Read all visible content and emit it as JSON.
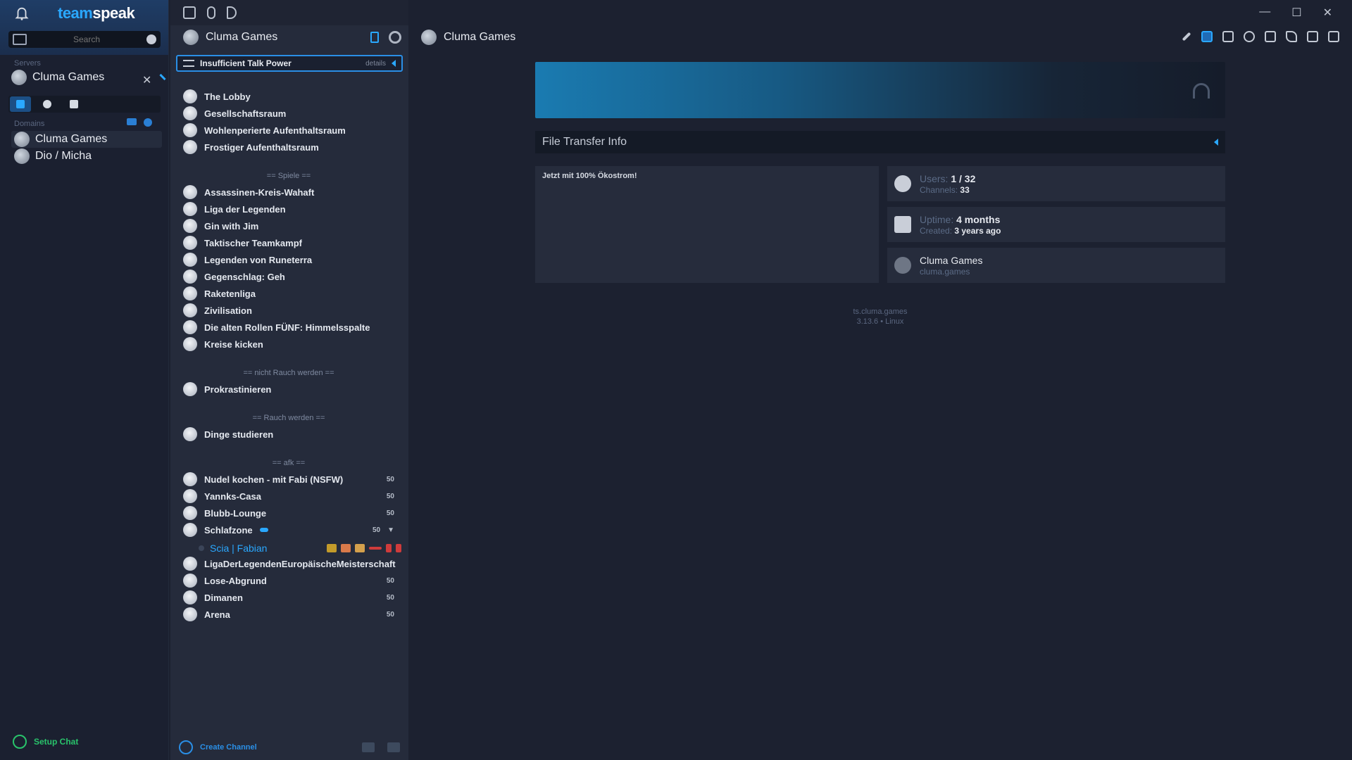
{
  "app": {
    "brand_part1": "team",
    "brand_part2": "speak"
  },
  "sidebar": {
    "search_placeholder": "Search",
    "servers_label": "Servers",
    "active_server": "Cluma Games",
    "domains_label": "Domains",
    "domain_items": [
      {
        "label": "Cluma Games"
      },
      {
        "label": "Dio / Micha"
      }
    ],
    "setup_chat": "Setup Chat"
  },
  "tree": {
    "server_name": "Cluma Games",
    "notice": {
      "text": "Insufficient Talk Power",
      "details": "details"
    },
    "group1": [
      "The Lobby",
      "Gesellschaftsraum",
      "Wohlenperierte Aufenthaltsraum",
      "Frostiger Aufenthaltsraum"
    ],
    "spacer_games": "== Spiele ==",
    "group2": [
      "Assassinen-Kreis-Wahaft",
      "Liga der Legenden",
      "Gin with Jim",
      "Taktischer Teamkampf",
      "Legenden von Runeterra",
      "Gegenschlag: Geh",
      "Raketenliga",
      "Zivilisation",
      "Die alten Rollen FÜNF: Himmelsspalte",
      "Kreise kicken"
    ],
    "spacer_no_touch": "== nicht Rauch werden ==",
    "group3": [
      "Prokrastinieren"
    ],
    "spacer_touch": "== Rauch werden ==",
    "group4": [
      "Dinge studieren"
    ],
    "spacer_afk": "== afk ==",
    "group5": [
      {
        "name": "Nudel kochen - mit Fabi (NSFW)",
        "count": "50"
      },
      {
        "name": "Yannks-Casa",
        "count": "50"
      },
      {
        "name": "Blubb-Lounge",
        "count": "50"
      },
      {
        "name": "Schlafzone",
        "count": "50"
      }
    ],
    "user": {
      "name": "Scia | Fabian"
    },
    "group6": [
      {
        "name": "LigaDerLegendenEuropäischeMeisterschaft",
        "count": ""
      },
      {
        "name": "Lose-Abgrund",
        "count": "50"
      },
      {
        "name": "Dimanen",
        "count": "50"
      },
      {
        "name": "Arena",
        "count": "50"
      }
    ],
    "create_channel": "Create Channel"
  },
  "main": {
    "title": "Cluma Games",
    "file_transfer": "File Transfer Info",
    "description": "Jetzt mit 100% Ökostrom!",
    "stats": {
      "users_k": "Users:",
      "users_v": "1 / 32",
      "channels_k": "Channels:",
      "channels_v": "33",
      "uptime_k": "Uptime:",
      "uptime_v": "4 months",
      "created_k": "Created:",
      "created_v": "3 years ago",
      "server_name": "Cluma Games",
      "server_sub": "cluma.games"
    },
    "footer_line1": "ts.cluma.games",
    "footer_line2": "3.13.6 • Linux"
  },
  "colors": {
    "accent": "#2aa8ff",
    "green": "#29c36b"
  }
}
